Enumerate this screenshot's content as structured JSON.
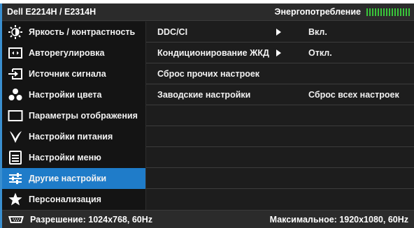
{
  "header": {
    "model": "Dell E2214H / E2314H",
    "energy_label": "Энергопотребление",
    "energy_bar_color": "#39c63a",
    "energy_level": 1.0
  },
  "sidebar": {
    "items": [
      {
        "label": "Яркость / контрастность",
        "icon": "brightness-icon"
      },
      {
        "label": "Авторегулировка",
        "icon": "auto-adjust-icon"
      },
      {
        "label": "Источник сигнала",
        "icon": "input-source-icon"
      },
      {
        "label": "Настройки цвета",
        "icon": "color-settings-icon"
      },
      {
        "label": "Параметры отображения",
        "icon": "display-settings-icon"
      },
      {
        "label": "Настройки питания",
        "icon": "power-settings-icon"
      },
      {
        "label": "Настройки меню",
        "icon": "menu-settings-icon"
      },
      {
        "label": "Другие настройки",
        "icon": "other-settings-icon",
        "active": true
      },
      {
        "label": "Персонализация",
        "icon": "star-icon"
      }
    ],
    "active_color": "#1f7cc9"
  },
  "content": {
    "rows": [
      {
        "label": "DDC/CI",
        "arrow": true,
        "value": "Вкл."
      },
      {
        "label": "Кондиционирование ЖКД",
        "arrow": true,
        "value": "Откл."
      },
      {
        "label": "Сброс прочих настроек",
        "arrow": false,
        "value": ""
      },
      {
        "label": "Заводские настройки",
        "arrow": false,
        "value": "Сброс всех настроек"
      },
      {
        "label": "",
        "arrow": false,
        "value": ""
      },
      {
        "label": "",
        "arrow": false,
        "value": ""
      },
      {
        "label": "",
        "arrow": false,
        "value": ""
      },
      {
        "label": "",
        "arrow": false,
        "value": ""
      },
      {
        "label": "",
        "arrow": false,
        "value": ""
      }
    ]
  },
  "status": {
    "resolution": "Разрешение: 1024x768,  60Hz",
    "max_resolution": "Максимальное: 1920x1080,  60Hz",
    "icon": "monitor-connector-icon"
  }
}
